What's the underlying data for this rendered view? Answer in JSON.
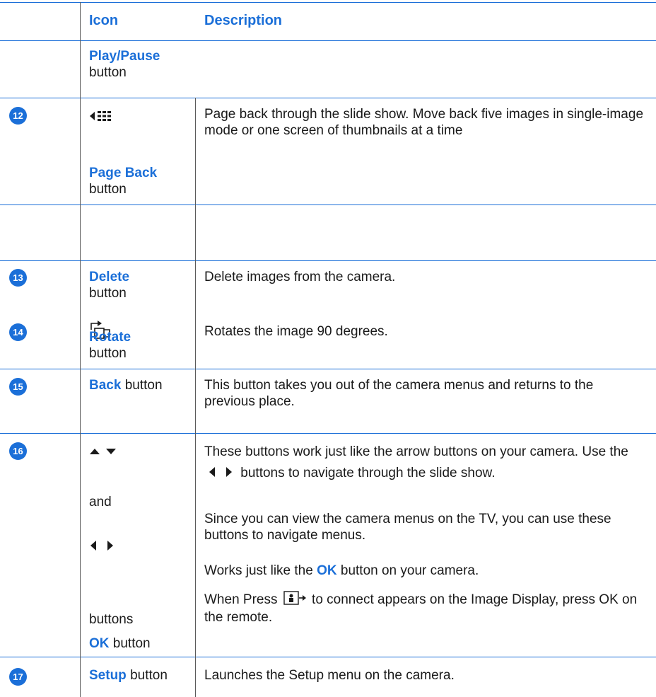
{
  "header": {
    "icon_col": "Icon",
    "description_col": "Description"
  },
  "rows": [
    {
      "label_bold": "Play/Pause",
      "label_rest": "button"
    },
    {
      "number": "12",
      "label_bold": "Page Back",
      "label_rest": "button",
      "description": "Page back through the slide show. Move back five images in single-image mode or one screen of thumbnails at a time",
      "icon": "page-back-icon"
    },
    {
      "number": "13",
      "label_bold": "Delete",
      "label_rest": "button",
      "description": "Delete images from the camera."
    },
    {
      "number": "14",
      "label_bold": "Rotate",
      "label_rest": "button",
      "description": "Rotates the image 90 degrees.",
      "icon": "rotate-icon"
    },
    {
      "number": "15",
      "label_bold": "Back",
      "label_rest": "button",
      "description": "This button takes you out of the camera menus and returns to the previous place."
    },
    {
      "number": "16",
      "label_and": "and",
      "label_buttons": "buttons",
      "ok_bold": "OK",
      "ok_rest": "button",
      "desc1_a": "These buttons work just like the arrow buttons on your camera. Use the",
      "desc1_b": "buttons to navigate through the slide show.",
      "desc2": "Since you can view the camera menus on the TV, you can use these buttons to navigate menus.",
      "desc3_a": "Works just like the",
      "desc3_ok": "OK",
      "desc3_b": "button on your camera.",
      "desc4_a": "When Press",
      "desc4_b": "to connect appears on the Image Display, press OK on the remote.",
      "icons": [
        "up-arrow-icon",
        "down-arrow-icon",
        "left-arrow-icon",
        "right-arrow-icon",
        "connect-icon"
      ]
    },
    {
      "number": "17",
      "label_bold": "Setup",
      "label_rest": "button",
      "description": "Launches the Setup menu on the camera."
    }
  ],
  "colors": {
    "accent": "#1b6fd8",
    "text": "#1a1a1a",
    "divider": "#5a5a5a"
  }
}
